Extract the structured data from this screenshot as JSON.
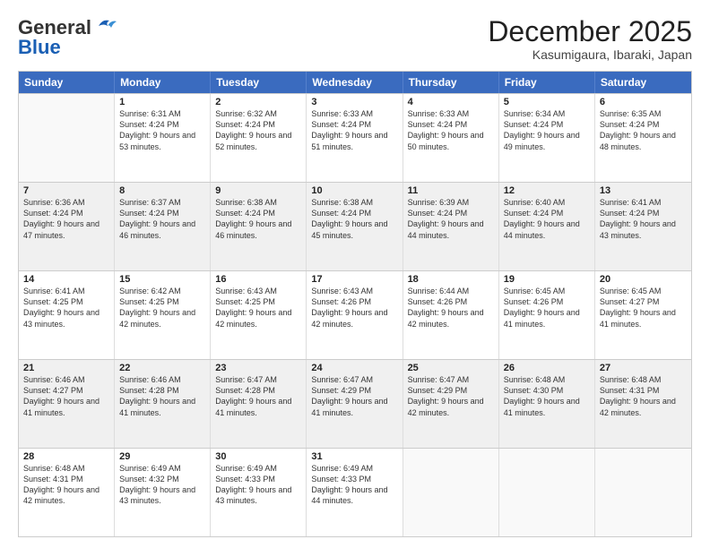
{
  "header": {
    "logo_general": "General",
    "logo_blue": "Blue",
    "month_year": "December 2025",
    "location": "Kasumigaura, Ibaraki, Japan"
  },
  "weekdays": [
    "Sunday",
    "Monday",
    "Tuesday",
    "Wednesday",
    "Thursday",
    "Friday",
    "Saturday"
  ],
  "rows": [
    [
      {
        "day": "",
        "sunrise": "",
        "sunset": "",
        "daylight": "",
        "empty": true
      },
      {
        "day": "1",
        "sunrise": "Sunrise: 6:31 AM",
        "sunset": "Sunset: 4:24 PM",
        "daylight": "Daylight: 9 hours and 53 minutes."
      },
      {
        "day": "2",
        "sunrise": "Sunrise: 6:32 AM",
        "sunset": "Sunset: 4:24 PM",
        "daylight": "Daylight: 9 hours and 52 minutes."
      },
      {
        "day": "3",
        "sunrise": "Sunrise: 6:33 AM",
        "sunset": "Sunset: 4:24 PM",
        "daylight": "Daylight: 9 hours and 51 minutes."
      },
      {
        "day": "4",
        "sunrise": "Sunrise: 6:33 AM",
        "sunset": "Sunset: 4:24 PM",
        "daylight": "Daylight: 9 hours and 50 minutes."
      },
      {
        "day": "5",
        "sunrise": "Sunrise: 6:34 AM",
        "sunset": "Sunset: 4:24 PM",
        "daylight": "Daylight: 9 hours and 49 minutes."
      },
      {
        "day": "6",
        "sunrise": "Sunrise: 6:35 AM",
        "sunset": "Sunset: 4:24 PM",
        "daylight": "Daylight: 9 hours and 48 minutes."
      }
    ],
    [
      {
        "day": "7",
        "sunrise": "Sunrise: 6:36 AM",
        "sunset": "Sunset: 4:24 PM",
        "daylight": "Daylight: 9 hours and 47 minutes."
      },
      {
        "day": "8",
        "sunrise": "Sunrise: 6:37 AM",
        "sunset": "Sunset: 4:24 PM",
        "daylight": "Daylight: 9 hours and 46 minutes."
      },
      {
        "day": "9",
        "sunrise": "Sunrise: 6:38 AM",
        "sunset": "Sunset: 4:24 PM",
        "daylight": "Daylight: 9 hours and 46 minutes."
      },
      {
        "day": "10",
        "sunrise": "Sunrise: 6:38 AM",
        "sunset": "Sunset: 4:24 PM",
        "daylight": "Daylight: 9 hours and 45 minutes."
      },
      {
        "day": "11",
        "sunrise": "Sunrise: 6:39 AM",
        "sunset": "Sunset: 4:24 PM",
        "daylight": "Daylight: 9 hours and 44 minutes."
      },
      {
        "day": "12",
        "sunrise": "Sunrise: 6:40 AM",
        "sunset": "Sunset: 4:24 PM",
        "daylight": "Daylight: 9 hours and 44 minutes."
      },
      {
        "day": "13",
        "sunrise": "Sunrise: 6:41 AM",
        "sunset": "Sunset: 4:24 PM",
        "daylight": "Daylight: 9 hours and 43 minutes."
      }
    ],
    [
      {
        "day": "14",
        "sunrise": "Sunrise: 6:41 AM",
        "sunset": "Sunset: 4:25 PM",
        "daylight": "Daylight: 9 hours and 43 minutes."
      },
      {
        "day": "15",
        "sunrise": "Sunrise: 6:42 AM",
        "sunset": "Sunset: 4:25 PM",
        "daylight": "Daylight: 9 hours and 42 minutes."
      },
      {
        "day": "16",
        "sunrise": "Sunrise: 6:43 AM",
        "sunset": "Sunset: 4:25 PM",
        "daylight": "Daylight: 9 hours and 42 minutes."
      },
      {
        "day": "17",
        "sunrise": "Sunrise: 6:43 AM",
        "sunset": "Sunset: 4:26 PM",
        "daylight": "Daylight: 9 hours and 42 minutes."
      },
      {
        "day": "18",
        "sunrise": "Sunrise: 6:44 AM",
        "sunset": "Sunset: 4:26 PM",
        "daylight": "Daylight: 9 hours and 42 minutes."
      },
      {
        "day": "19",
        "sunrise": "Sunrise: 6:45 AM",
        "sunset": "Sunset: 4:26 PM",
        "daylight": "Daylight: 9 hours and 41 minutes."
      },
      {
        "day": "20",
        "sunrise": "Sunrise: 6:45 AM",
        "sunset": "Sunset: 4:27 PM",
        "daylight": "Daylight: 9 hours and 41 minutes."
      }
    ],
    [
      {
        "day": "21",
        "sunrise": "Sunrise: 6:46 AM",
        "sunset": "Sunset: 4:27 PM",
        "daylight": "Daylight: 9 hours and 41 minutes."
      },
      {
        "day": "22",
        "sunrise": "Sunrise: 6:46 AM",
        "sunset": "Sunset: 4:28 PM",
        "daylight": "Daylight: 9 hours and 41 minutes."
      },
      {
        "day": "23",
        "sunrise": "Sunrise: 6:47 AM",
        "sunset": "Sunset: 4:28 PM",
        "daylight": "Daylight: 9 hours and 41 minutes."
      },
      {
        "day": "24",
        "sunrise": "Sunrise: 6:47 AM",
        "sunset": "Sunset: 4:29 PM",
        "daylight": "Daylight: 9 hours and 41 minutes."
      },
      {
        "day": "25",
        "sunrise": "Sunrise: 6:47 AM",
        "sunset": "Sunset: 4:29 PM",
        "daylight": "Daylight: 9 hours and 42 minutes."
      },
      {
        "day": "26",
        "sunrise": "Sunrise: 6:48 AM",
        "sunset": "Sunset: 4:30 PM",
        "daylight": "Daylight: 9 hours and 41 minutes."
      },
      {
        "day": "27",
        "sunrise": "Sunrise: 6:48 AM",
        "sunset": "Sunset: 4:31 PM",
        "daylight": "Daylight: 9 hours and 42 minutes."
      }
    ],
    [
      {
        "day": "28",
        "sunrise": "Sunrise: 6:48 AM",
        "sunset": "Sunset: 4:31 PM",
        "daylight": "Daylight: 9 hours and 42 minutes."
      },
      {
        "day": "29",
        "sunrise": "Sunrise: 6:49 AM",
        "sunset": "Sunset: 4:32 PM",
        "daylight": "Daylight: 9 hours and 43 minutes."
      },
      {
        "day": "30",
        "sunrise": "Sunrise: 6:49 AM",
        "sunset": "Sunset: 4:33 PM",
        "daylight": "Daylight: 9 hours and 43 minutes."
      },
      {
        "day": "31",
        "sunrise": "Sunrise: 6:49 AM",
        "sunset": "Sunset: 4:33 PM",
        "daylight": "Daylight: 9 hours and 44 minutes."
      },
      {
        "day": "",
        "sunrise": "",
        "sunset": "",
        "daylight": "",
        "empty": true
      },
      {
        "day": "",
        "sunrise": "",
        "sunset": "",
        "daylight": "",
        "empty": true
      },
      {
        "day": "",
        "sunrise": "",
        "sunset": "",
        "daylight": "",
        "empty": true
      }
    ]
  ]
}
